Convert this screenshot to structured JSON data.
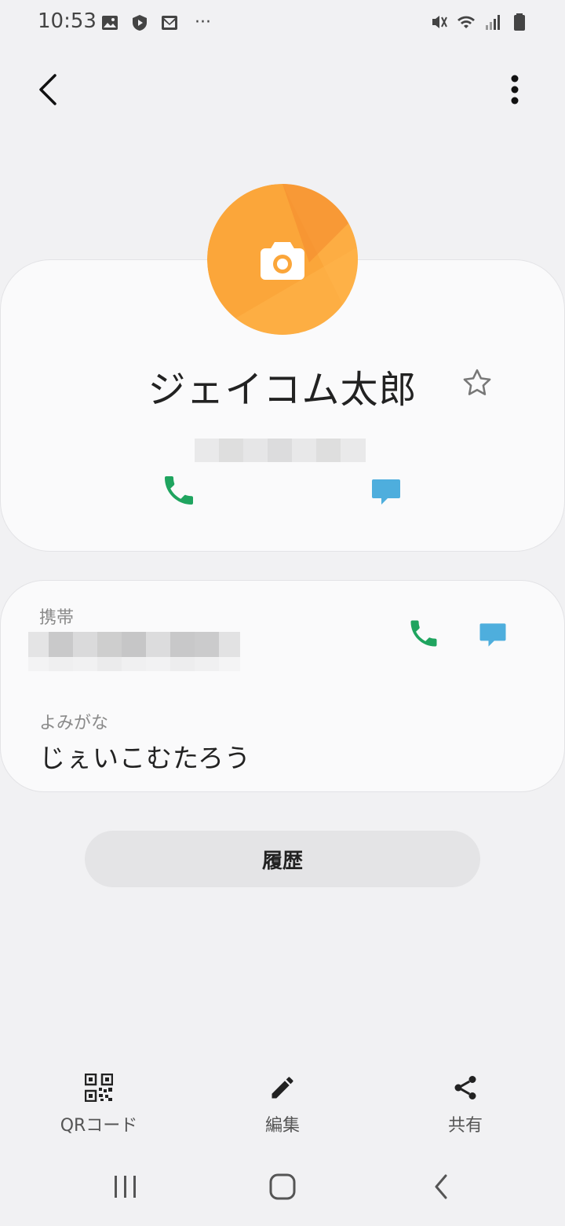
{
  "status_bar": {
    "time": "10:53",
    "left_icons": [
      "gallery-icon",
      "shield-icon",
      "media-icon",
      "mail-icon",
      "more-dots"
    ],
    "right_icons": [
      "mute-vibrate-icon",
      "wifi-icon",
      "signal-icon",
      "battery-icon"
    ],
    "more_notifications": "···"
  },
  "app_bar": {
    "back_icon": "chevron-left-icon",
    "more_icon": "vertical-dots-icon"
  },
  "contact": {
    "name": "ジェイコム太郎",
    "avatar_colors": [
      "#fba63a",
      "#f7902f",
      "#ffb24a"
    ],
    "avatar_icon": "camera-icon",
    "favorite_icon": "star-outline-icon"
  },
  "colors": {
    "call": "#1fa45f",
    "message": "#4eaedd",
    "background": "#f1f1f3",
    "card": "#fafafb"
  },
  "info": {
    "mobile_label": "携帯",
    "reading_label": "よみがな",
    "reading_value": "じぇいこむたろう"
  },
  "history_button": "履歴",
  "bottom_actions": [
    {
      "label": "QRコード",
      "icon": "qr-code-icon"
    },
    {
      "label": "編集",
      "icon": "pencil-icon"
    },
    {
      "label": "共有",
      "icon": "share-icon"
    }
  ],
  "nav_bar": [
    "recents-icon",
    "home-icon",
    "back-icon"
  ]
}
